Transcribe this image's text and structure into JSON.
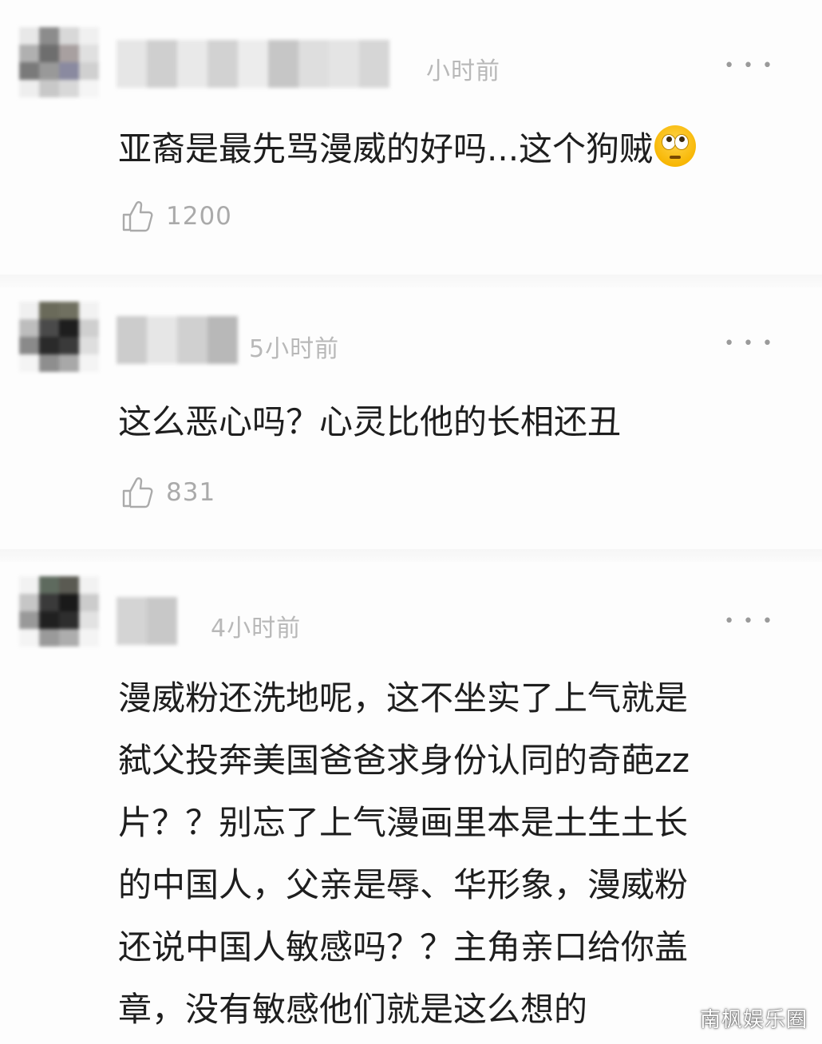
{
  "comments": [
    {
      "time": "小时前",
      "more_label": "• • •",
      "lines": [
        "亚裔是最先骂漫威的好吗...这个狗贼"
      ],
      "emoji": "eye-roll-emoji",
      "likes": "1200"
    },
    {
      "time": "5小时前",
      "more_label": "• • •",
      "lines": [
        "这么恶心吗？心灵比他的长相还丑"
      ],
      "likes": "831"
    },
    {
      "time": "4小时前",
      "more_label": "• • •",
      "lines": [
        "漫威粉还洗地呢，这不坐实了上气就是",
        "弑父投奔美国爸爸求身份认同的奇葩zz",
        "片？？别忘了上气漫画里本是土生土长",
        "的中国人，父亲是辱、华形象，漫威粉",
        "还说中国人敏感吗？？主角亲口给你盖",
        "章，没有敏感他们就是这么想的"
      ]
    }
  ],
  "watermark": "南枫娱乐圈",
  "colors": {
    "text": "#1e1e1e",
    "meta": "#b8b8b8",
    "like_icon": "#aaaaaa"
  }
}
